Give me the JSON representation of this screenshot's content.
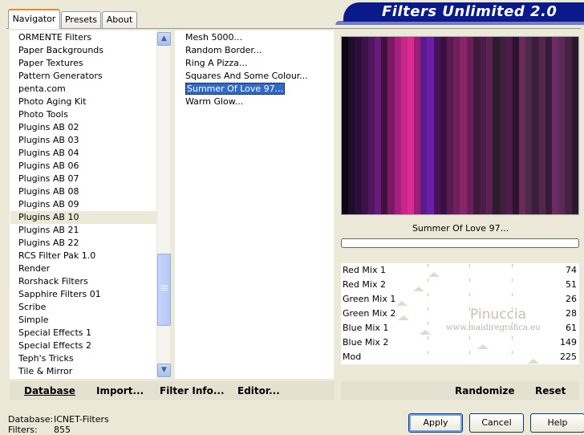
{
  "tabs": [
    {
      "label": "Navigator",
      "active": true
    },
    {
      "label": "Presets",
      "active": false
    },
    {
      "label": "About",
      "active": false
    }
  ],
  "title": "Filters Unlimited 2.0",
  "categories": [
    "ORMENTE Filters",
    "Paper Backgrounds",
    "Paper Textures",
    "Pattern Generators",
    "penta.com",
    "Photo Aging Kit",
    "Photo Tools",
    "Plugins AB 02",
    "Plugins AB 03",
    "Plugins AB 04",
    "Plugins AB 06",
    "Plugins AB 07",
    "Plugins AB 08",
    "Plugins AB 09",
    "Plugins AB 10",
    "Plugins AB 21",
    "Plugins AB 22",
    "RCS Filter Pak 1.0",
    "Render",
    "Rorshack Filters",
    "Sapphire Filters 01",
    "Scribe",
    "Simple",
    "Special Effects 1",
    "Special Effects 2",
    "Teph's Tricks",
    "Tile & Mirror"
  ],
  "selected_category": "Plugins AB 10",
  "filters": [
    "Mesh 5000...",
    "Random Border...",
    "Ring A Pizza...",
    "Squares And Some Colour...",
    "Summer Of Love 97...",
    "Warm Glow..."
  ],
  "selected_filter": "Summer Of Love 97...",
  "preview_filter_name": "Summer Of Love 97...",
  "sliders": [
    {
      "label": "Red Mix 1",
      "value": "74",
      "fraction": 0.29
    },
    {
      "label": "Red Mix 2",
      "value": "51",
      "fraction": 0.2
    },
    {
      "label": "Green Mix 1",
      "value": "26",
      "fraction": 0.1
    },
    {
      "label": "Green Mix 2",
      "value": "28",
      "fraction": 0.11
    },
    {
      "label": "Blue Mix 1",
      "value": "61",
      "fraction": 0.24
    },
    {
      "label": "Blue Mix 2",
      "value": "149",
      "fraction": 0.58
    },
    {
      "label": "Mod",
      "value": "225",
      "fraction": 0.88
    }
  ],
  "watermark": {
    "name": "Pinuccia",
    "url": "www.maidiregrafica.eu"
  },
  "bottom_buttons": {
    "database": "Database",
    "import": "Import...",
    "filter_info": "Filter Info...",
    "editor": "Editor..."
  },
  "right_buttons": {
    "randomize": "Randomize",
    "reset": "Reset"
  },
  "status": {
    "database_label": "Database:",
    "database_value": "ICNET-Filters",
    "filters_label": "Filters:",
    "filters_value": "855"
  },
  "dialog_buttons": {
    "apply": "Apply",
    "cancel": "Cancel",
    "help": "Help"
  },
  "preview_colors": [
    "#0d0414",
    "#1d0d29",
    "#2b0e3a",
    "#3c1248",
    "#501660",
    "#6a1a7a",
    "#40103f",
    "#7a1a66",
    "#a4207c",
    "#c8268a",
    "#dd2a92",
    "#9b1f72",
    "#5a1b8e",
    "#6d1ea8",
    "#47145a",
    "#3a1042",
    "#5c1a52",
    "#6e1f5c",
    "#8a2468",
    "#6a1e5a",
    "#3e1a3a",
    "#4a1c46",
    "#5a2250",
    "#2f1b2e",
    "#3a2238",
    "#4e1b4a",
    "#2c1430",
    "#6a2a5a",
    "#4b2a4b",
    "#3a1e3a",
    "#52264e",
    "#341c36",
    "#6e2a62",
    "#5c2a56",
    "#462242",
    "#2a1830"
  ],
  "colors": {
    "title_bg": "#0a1a8a",
    "selection": "#316ac5",
    "window_bg": "#ece9d8"
  }
}
